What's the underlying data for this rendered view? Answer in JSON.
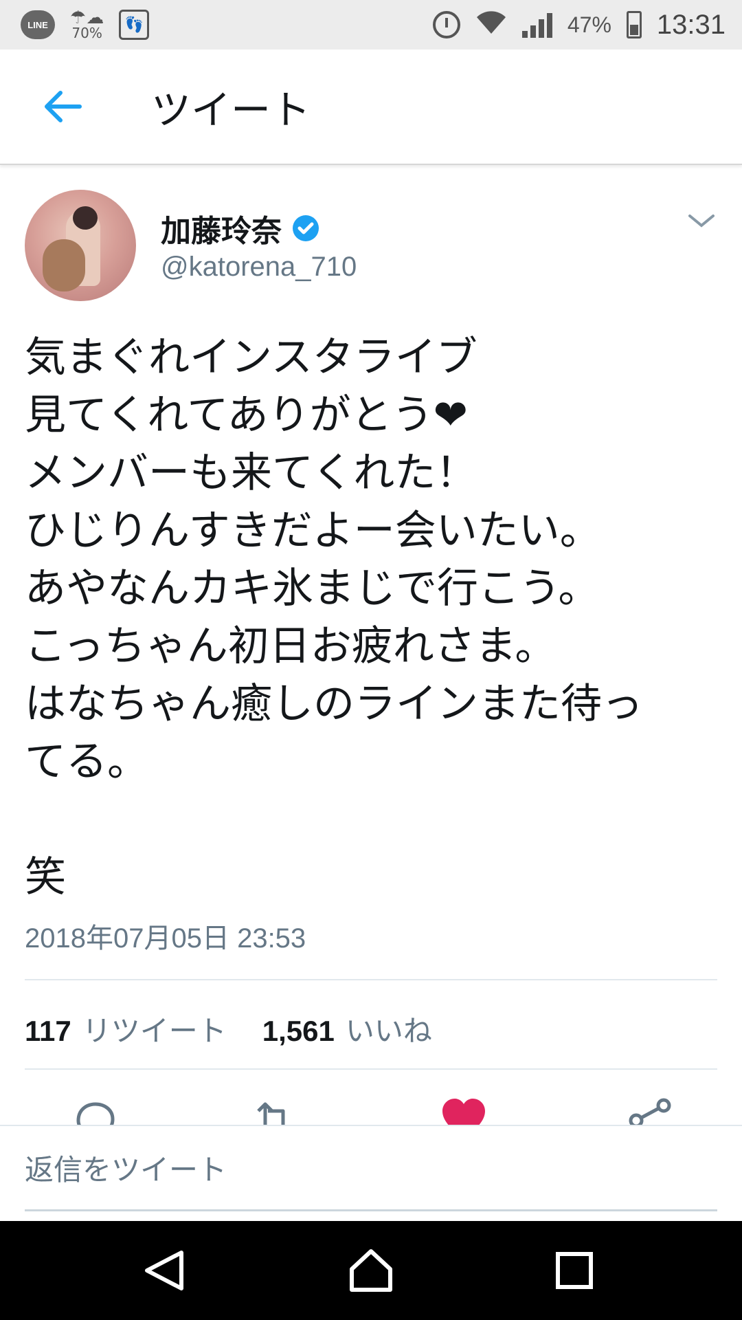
{
  "status_bar": {
    "line_label": "LINE",
    "weather_percent": "70%",
    "battery": "47%",
    "time": "13:31"
  },
  "header": {
    "title": "ツイート"
  },
  "tweet": {
    "author_name": "加藤玲奈",
    "handle": "@katorena_710",
    "text": "気まぐれインスタライブ\n見てくれてありがとう❤\nメンバーも来てくれた！\nひじりんすきだよー会いたい。\nあやなんカキ氷まじで行こう。\nこっちゃん初日お疲れさま。\nはなちゃん癒しのラインまた待っ\nてる。\n\n笑",
    "timestamp": "2018年07月05日 23:53",
    "retweet_count": "117",
    "retweet_label": "リツイート",
    "like_count": "1,561",
    "like_label": "いいね"
  },
  "reply": {
    "placeholder": "返信をツイート"
  },
  "colors": {
    "accent": "#1da1f2",
    "like": "#e0245e",
    "secondary_text": "#657786"
  }
}
